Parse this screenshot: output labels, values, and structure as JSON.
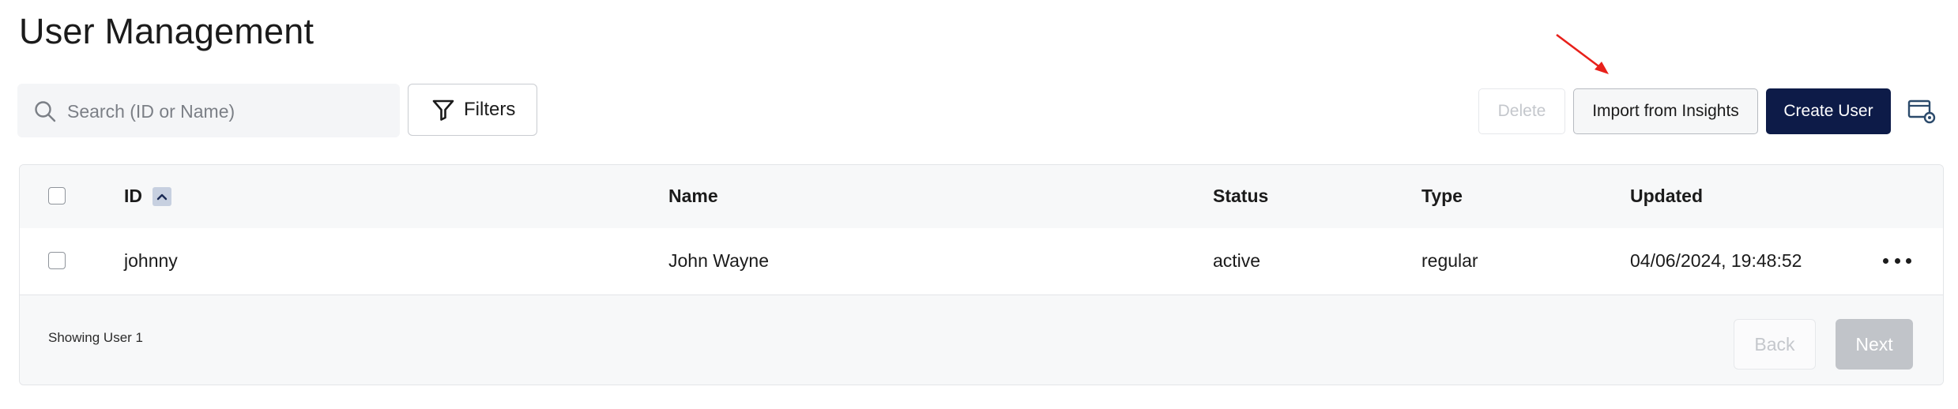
{
  "page": {
    "title": "User Management"
  },
  "search": {
    "placeholder": "Search (ID or Name)",
    "value": ""
  },
  "filters": {
    "label": "Filters"
  },
  "actions": {
    "delete_label": "Delete",
    "import_label": "Import from Insights",
    "create_label": "Create User"
  },
  "table": {
    "columns": [
      "ID",
      "Name",
      "Status",
      "Type",
      "Updated"
    ],
    "rows": [
      {
        "id": "johnny",
        "name": "John Wayne",
        "status": "active",
        "type": "regular",
        "updated": "04/06/2024, 19:48:52"
      }
    ]
  },
  "footer": {
    "showing": "Showing User 1",
    "back_label": "Back",
    "next_label": "Next"
  },
  "colors": {
    "primary": "#0d1b48",
    "annotation_arrow": "#e8201a",
    "sort_badge": "#c7d0e0"
  },
  "icons": [
    "search-icon",
    "filter-icon",
    "table-settings-icon",
    "sort-ascending-icon",
    "more-actions-icon",
    "annotation-arrow"
  ]
}
